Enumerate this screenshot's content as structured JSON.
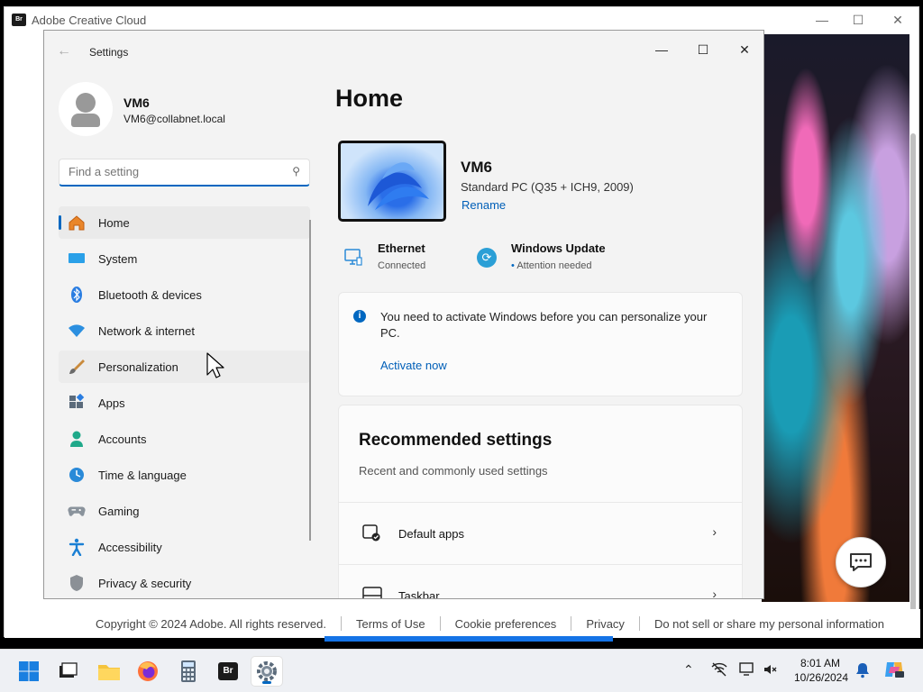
{
  "background_window": {
    "title": "Adobe Creative Cloud",
    "logo": "Br",
    "footer": {
      "copyright": "Copyright © 2024 Adobe. All rights reserved.",
      "links": [
        "Terms of Use",
        "Cookie preferences",
        "Privacy",
        "Do not sell or share my personal information"
      ]
    }
  },
  "settings": {
    "window_title": "Settings",
    "user": {
      "name": "VM6",
      "email": "VM6@collabnet.local"
    },
    "search": {
      "placeholder": "Find a setting"
    },
    "nav": [
      {
        "label": "Home",
        "icon": "home-icon",
        "active": true
      },
      {
        "label": "System",
        "icon": "system-icon"
      },
      {
        "label": "Bluetooth & devices",
        "icon": "bluetooth-icon"
      },
      {
        "label": "Network & internet",
        "icon": "wifi-icon"
      },
      {
        "label": "Personalization",
        "icon": "brush-icon",
        "hover": true
      },
      {
        "label": "Apps",
        "icon": "apps-icon"
      },
      {
        "label": "Accounts",
        "icon": "accounts-icon"
      },
      {
        "label": "Time & language",
        "icon": "clock-globe-icon"
      },
      {
        "label": "Gaming",
        "icon": "gamepad-icon"
      },
      {
        "label": "Accessibility",
        "icon": "accessibility-icon"
      },
      {
        "label": "Privacy & security",
        "icon": "shield-icon"
      }
    ],
    "home": {
      "title": "Home",
      "device": {
        "name": "VM6",
        "spec": "Standard PC (Q35 + ICH9, 2009)",
        "rename": "Rename"
      },
      "ethernet": {
        "label": "Ethernet",
        "status": "Connected"
      },
      "windows_update": {
        "label": "Windows Update",
        "status": "Attention needed"
      },
      "activation": {
        "message": "You need to activate Windows before you can personalize your PC.",
        "link": "Activate now"
      },
      "recommended": {
        "title": "Recommended settings",
        "subtitle": "Recent and commonly used settings",
        "items": [
          {
            "label": "Default apps",
            "icon": "default-apps-icon"
          },
          {
            "label": "Taskbar",
            "icon": "taskbar-icon"
          }
        ]
      }
    }
  },
  "taskbar": {
    "time": "8:01 AM",
    "date": "10/26/2024",
    "apps": [
      "start-icon",
      "file-explorer-icon",
      "folder-icon",
      "firefox-icon",
      "calculator-icon",
      "bridge-icon",
      "settings-icon"
    ],
    "bridge_label": "Br"
  },
  "colors": {
    "accent": "#0067c0",
    "adobe_blue": "#1473e6"
  }
}
